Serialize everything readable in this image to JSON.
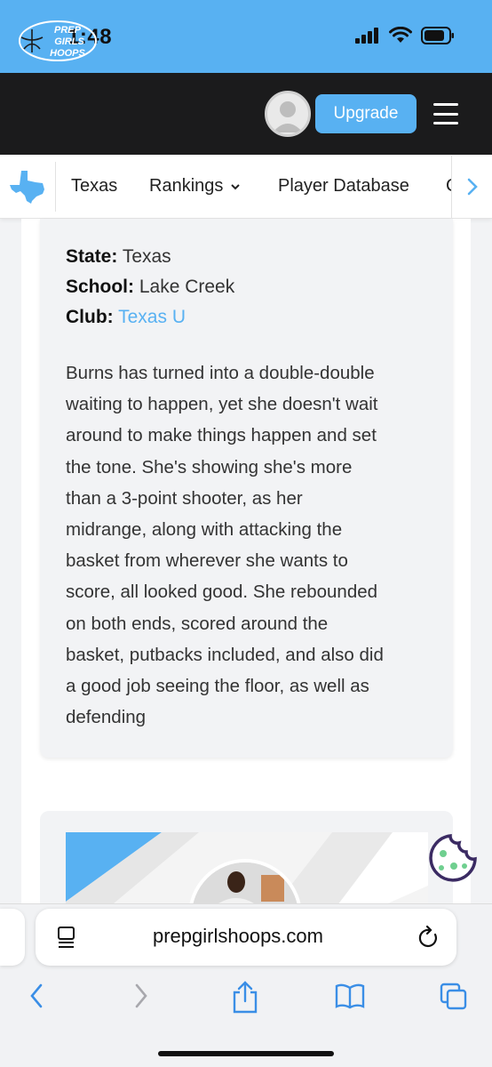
{
  "status_bar": {
    "time": "1:48"
  },
  "header": {
    "logo_text": [
      "PREP",
      "GIRLS",
      "HOOPS"
    ],
    "upgrade_label": "Upgrade"
  },
  "sub_nav": {
    "items": [
      "Texas",
      "Rankings",
      "Player Database",
      "C"
    ]
  },
  "profile": {
    "state_label": "State:",
    "state_value": "Texas",
    "school_label": "School:",
    "school_value": "Lake Creek",
    "club_label": "Club:",
    "club_value": "Texas U",
    "bio_lines": [
      "Burns has turned into a double-double",
      "waiting to happen, yet she doesn't wait",
      "around to make things happen and set",
      "the tone. She's showing she's more",
      "than a 3-point shooter, as her",
      "midrange, along with attacking the",
      "basket from wherever she wants to",
      "score, all looked good. She rebounded",
      "on both ends, scored around the",
      "basket, putbacks included, and also did",
      "a good job seeing the floor, as well as",
      "defending"
    ]
  },
  "browser": {
    "url": "prepgirlshoops.com"
  },
  "colors": {
    "accent": "#58b1f2",
    "nav_dark": "#1b1b1c",
    "cookie": "#3b2b63",
    "cookie_dots": "#6fcf8f"
  },
  "icons": {
    "status": [
      "signal-icon",
      "wifi-icon",
      "battery-icon"
    ],
    "toolbar": [
      "back-icon",
      "forward-icon",
      "share-icon",
      "bookmarks-icon",
      "tabs-icon"
    ]
  }
}
